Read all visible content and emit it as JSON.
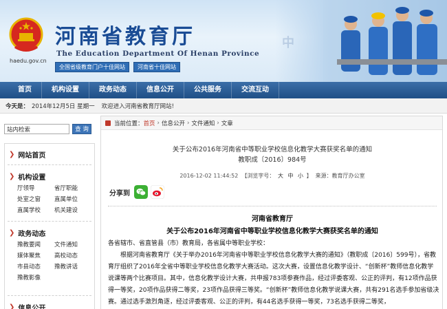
{
  "header": {
    "title_cn": "河南省教育厅",
    "title_en": "The Education Department Of Henan Province",
    "site_url": "haedu.gov.cn",
    "badge1": "全国省级教育门户十佳网站",
    "badge2": "河南省十佳网站",
    "watermark": "中"
  },
  "nav": {
    "items": [
      "首页",
      "机构设置",
      "政务动态",
      "信息公开",
      "公共服务",
      "交流互动"
    ]
  },
  "infobar": {
    "today_label": "今天是：",
    "date": "2014年12月5日 星期一",
    "welcome": "欢迎进入河南省教育厅网站!"
  },
  "search": {
    "placeholder": "站内检索",
    "button": "查 询"
  },
  "sidebar": {
    "sections": [
      {
        "title": "网站首页",
        "links": []
      },
      {
        "title": "机构设置",
        "links": [
          "厅领导",
          "省厅职能",
          "处室之窗",
          "直属单位",
          "直属学校",
          "机关建设"
        ]
      },
      {
        "title": "政务动态",
        "links": [
          "豫教要闻",
          "文件通知",
          "媒体聚焦",
          "高校动态",
          "市县动态",
          "豫教讲话",
          "豫教影像"
        ]
      },
      {
        "title": "信息公开",
        "links": []
      }
    ]
  },
  "breadcrumb": {
    "prefix": "当前位置：",
    "items": [
      "首页",
      "信息公开",
      "文件通知",
      "文章"
    ]
  },
  "document": {
    "title_line1": "关于公布2016年河南省中等职业学校信息化教学大赛获奖名单的通知",
    "title_line2": "教职成〔2016〕984号",
    "date": "2016-12-02 11:44:52",
    "views_label": "【浏览字号：",
    "font_sizes": [
      "大",
      "中",
      "小"
    ],
    "views_end": "】",
    "source": "来源：教育厅办公室",
    "share_label": "分享到",
    "heading1": "河南省教育厅",
    "heading2": "关于公布2016年河南省中等职业学校信息化教学大赛获奖名单的通知",
    "recipients": "各省辖市、省直管县（市）教育局，各省属中等职业学校：",
    "para1": "根据河南省教育厅《关于举办2016年河南省中等职业学校信息化教学大赛的通知》（教职成〔2016〕599号），省教育厅组织了2016年全省中等职业学校信息化教学大赛活动。这次大赛，设置信息化教学设计、“创新杯”教师信息化教学说课等两个比赛项目。其中，信息化教学设计大赛，共申报783项参赛作品，经过评委客观、公正的评判，有12项作品获得一等奖，20项作品获得二等奖，23项作品获得三等奖。“创新杯”教师信息化教学说课大赛，共有291名选手参加省级决赛。通过选手激烈角逐，经过评委客观、公正的评判，有44名选手获得一等奖，73名选手获得二等奖，"
  },
  "colors": {
    "nav_bg": "#1f4f86",
    "title_blue": "#1a4c95",
    "accent_red": "#c0392b",
    "search_btn": "#3d75b8"
  }
}
